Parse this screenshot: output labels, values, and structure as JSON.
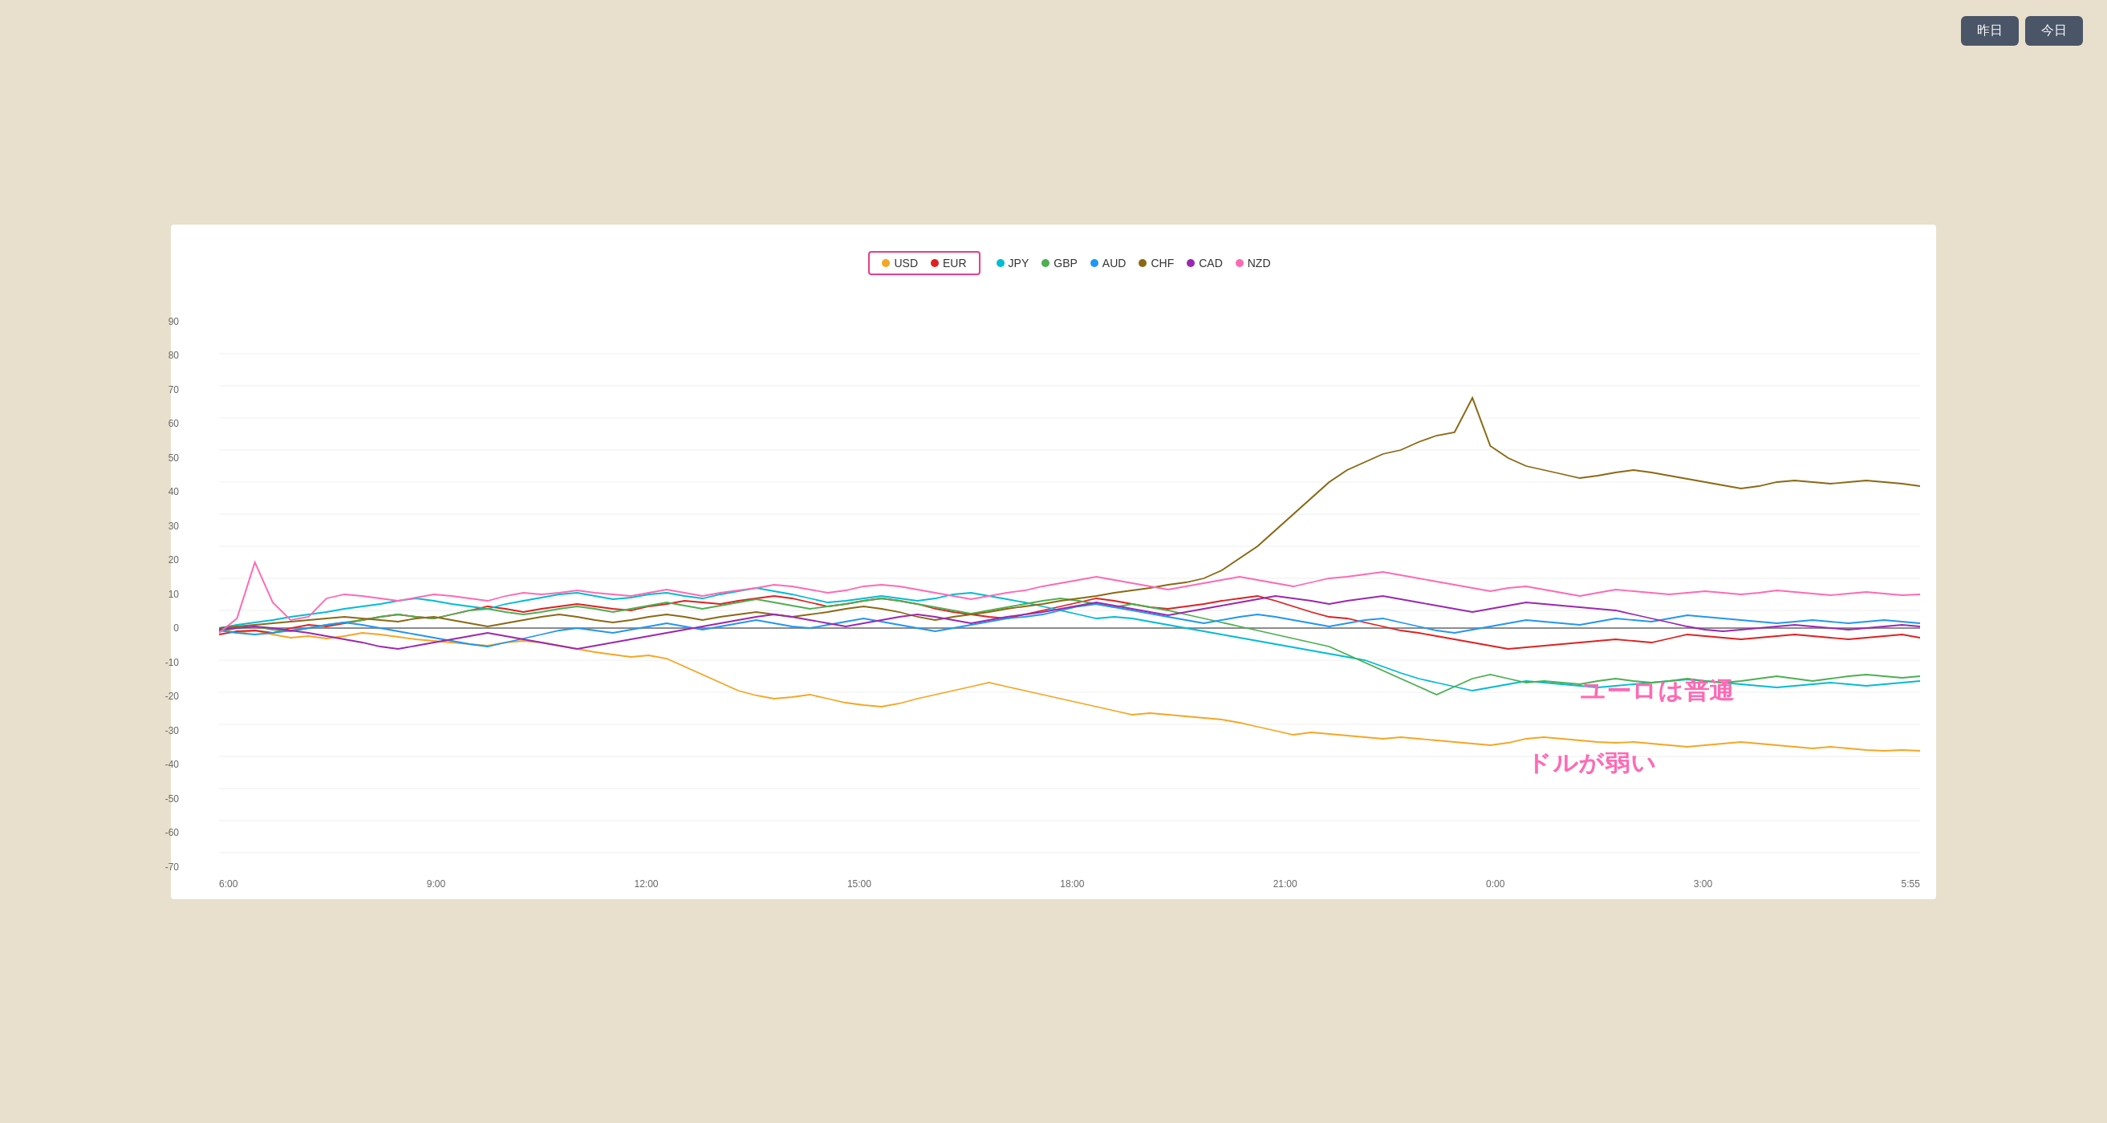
{
  "buttons": {
    "yesterday": "昨日",
    "today": "今日"
  },
  "legend": {
    "boxed": [
      "USD",
      "EUR"
    ],
    "rest": [
      "JPY",
      "GBP",
      "AUD",
      "CHF",
      "CAD",
      "NZD"
    ],
    "colors": {
      "USD": "#f5a623",
      "EUR": "#e02020",
      "JPY": "#00bcd4",
      "GBP": "#4caf50",
      "AUD": "#2196f3",
      "CHF": "#8b6914",
      "CAD": "#9c27b0",
      "NZD": "#ff69b4"
    }
  },
  "yAxis": [
    90,
    80,
    70,
    60,
    50,
    40,
    30,
    20,
    10,
    0,
    -10,
    -20,
    -30,
    -40,
    -50,
    -60,
    -70
  ],
  "xAxis": [
    "6:00",
    "9:00",
    "12:00",
    "15:00",
    "18:00",
    "21:00",
    "0:00",
    "3:00",
    "5:55"
  ],
  "annotations": {
    "euro": "ユーロは普通",
    "dollar": "ドルが弱い"
  }
}
